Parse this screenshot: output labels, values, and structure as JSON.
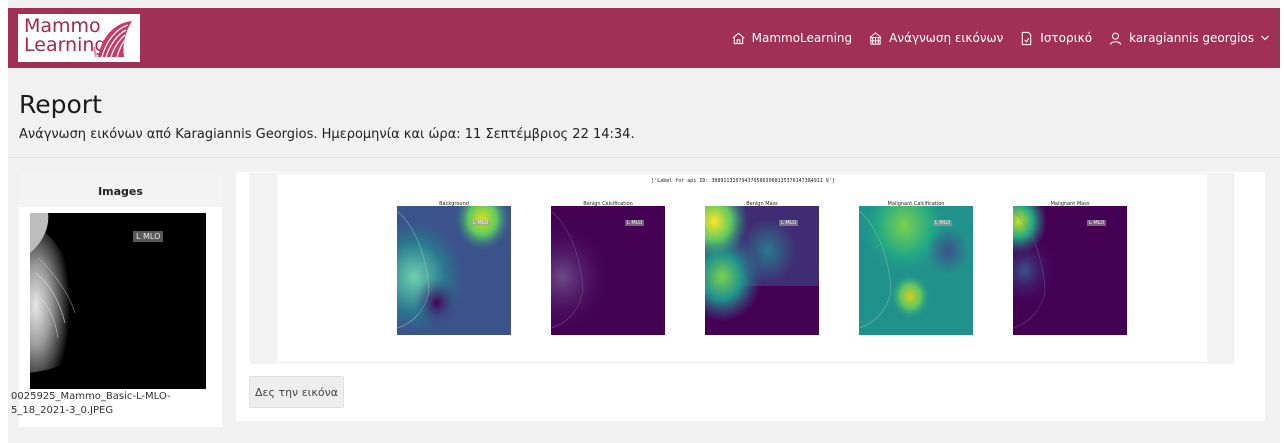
{
  "brand": {
    "logo_line1": "Mammo",
    "logo_line2": "Learning"
  },
  "nav": [
    {
      "icon": "home-icon",
      "label": "MammoLearning"
    },
    {
      "icon": "image-reader-icon",
      "label": "Ανάγνωση εικόνων"
    },
    {
      "icon": "document-icon",
      "label": "Ιστορικό"
    },
    {
      "icon": "user-icon",
      "label": "karagiannis georgios"
    }
  ],
  "header": {
    "title": "Report",
    "subtitle": "Ανάγνωση εικόνων από Karagiannis Georgios. Ημερομηνία και ώρα: 11 Σεπτέμβριος 22 14:34."
  },
  "images_panel": {
    "title": "Images",
    "thumbnail_view_label": "L MLO",
    "filename": "0025925_Mammo_Basic-L-MLO-5_18_2021-3_0.JPEG"
  },
  "report": {
    "figure_caption": "['Label for api ID: 3089113207943705863068135376147384911 9']",
    "subplots": [
      {
        "title": "Background",
        "tag": "L MLO"
      },
      {
        "title": "Benign Calcification",
        "tag": "L MLO"
      },
      {
        "title": "Benign Mass",
        "tag": "L MLO"
      },
      {
        "title": "Malignant Calcification",
        "tag": "L MLO"
      },
      {
        "title": "Malignant Mass",
        "tag": "L MLO"
      }
    ],
    "view_button_label": "Δες την εικόνα"
  },
  "colors": {
    "navbar": "#a13056",
    "brand_text": "#a3294f",
    "heatmap_low": "#440154",
    "heatmap_mid": "#21918c",
    "heatmap_high": "#fde725"
  }
}
